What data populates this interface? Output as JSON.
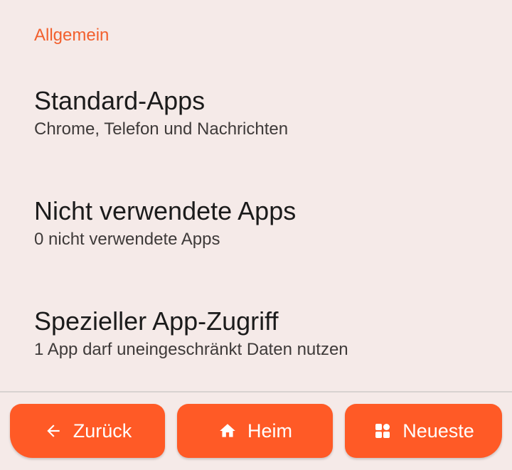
{
  "settings": {
    "section_header": "Allgemein",
    "items": [
      {
        "title": "Standard-Apps",
        "subtitle": "Chrome, Telefon und Nachrichten"
      },
      {
        "title": "Nicht verwendete Apps",
        "subtitle": "0 nicht verwendete Apps"
      },
      {
        "title": "Spezieller App-Zugriff",
        "subtitle": "1 App darf uneingeschränkt Daten nutzen"
      }
    ]
  },
  "navbar": {
    "back_label": "Zurück",
    "home_label": "Heim",
    "recent_label": "Neueste",
    "icons": {
      "back": "arrow-left-icon",
      "home": "home-icon",
      "recent": "apps-grid-icon"
    }
  },
  "colors": {
    "background": "#f5eae8",
    "accent": "#f2602e",
    "button": "#ff5a26"
  }
}
